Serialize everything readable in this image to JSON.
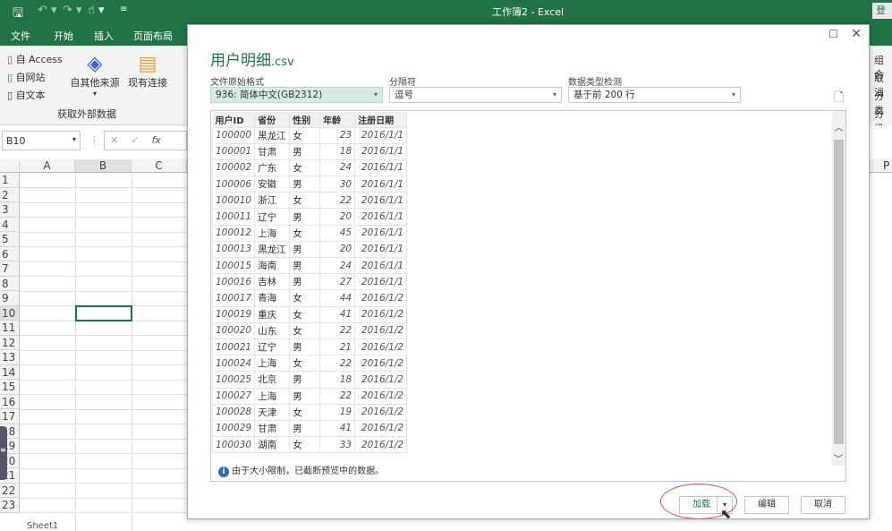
{
  "titlebar": {
    "title": "工作簿2 - Excel",
    "login": "登"
  },
  "tabs": [
    "文件",
    "开始",
    "插入",
    "页面布局"
  ],
  "ribbon": {
    "access": "自 Access",
    "web": "自网站",
    "text": "自文本",
    "other_sources": "自其他来源",
    "existing": "现有连接",
    "group_label": "获取外部数据",
    "right_items": [
      "组合",
      "取消",
      "分类",
      "分级"
    ]
  },
  "formula_bar": {
    "name_box": "B10",
    "fx": "fx"
  },
  "grid": {
    "columns": [
      "A",
      "B",
      "C"
    ],
    "right_col": "P",
    "rows": [
      "1",
      "2",
      "3",
      "4",
      "5",
      "6",
      "7",
      "8",
      "9",
      "10",
      "11",
      "12",
      "13",
      "14",
      "15",
      "16",
      "17",
      "18",
      "19",
      "20",
      "21",
      "22",
      "23"
    ],
    "selected_cell": "B10",
    "sheet_tab": "Sheet1"
  },
  "dialog": {
    "title": "用户明细",
    "title_ext": ".csv",
    "origin_label": "文件原始格式",
    "origin_value": "936: 简体中文(GB2312)",
    "delimiter_label": "分隔符",
    "delimiter_value": "逗号",
    "detect_label": "数据类型检测",
    "detect_value": "基于前 200 行",
    "columns": [
      "用户ID",
      "省份",
      "性别",
      "年龄",
      "注册日期"
    ],
    "rows": [
      [
        "100000",
        "黑龙江",
        "女",
        "23",
        "2016/1/1"
      ],
      [
        "100001",
        "甘肃",
        "男",
        "18",
        "2016/1/1"
      ],
      [
        "100002",
        "广东",
        "女",
        "24",
        "2016/1/1"
      ],
      [
        "100006",
        "安徽",
        "男",
        "30",
        "2016/1/1"
      ],
      [
        "100010",
        "浙江",
        "女",
        "22",
        "2016/1/1"
      ],
      [
        "100011",
        "辽宁",
        "男",
        "20",
        "2016/1/1"
      ],
      [
        "100012",
        "上海",
        "女",
        "45",
        "2016/1/1"
      ],
      [
        "100013",
        "黑龙江",
        "男",
        "20",
        "2016/1/1"
      ],
      [
        "100015",
        "海南",
        "男",
        "24",
        "2016/1/1"
      ],
      [
        "100016",
        "吉林",
        "男",
        "27",
        "2016/1/1"
      ],
      [
        "100017",
        "青海",
        "女",
        "44",
        "2016/1/2"
      ],
      [
        "100019",
        "重庆",
        "女",
        "41",
        "2016/1/2"
      ],
      [
        "100020",
        "山东",
        "女",
        "22",
        "2016/1/2"
      ],
      [
        "100021",
        "辽宁",
        "男",
        "21",
        "2016/1/2"
      ],
      [
        "100024",
        "上海",
        "女",
        "22",
        "2016/1/2"
      ],
      [
        "100025",
        "北京",
        "男",
        "18",
        "2016/1/2"
      ],
      [
        "100027",
        "上海",
        "男",
        "22",
        "2016/1/2"
      ],
      [
        "100028",
        "天津",
        "女",
        "19",
        "2016/1/2"
      ],
      [
        "100029",
        "甘肃",
        "男",
        "41",
        "2016/1/2"
      ],
      [
        "100030",
        "湖南",
        "女",
        "33",
        "2016/1/2"
      ]
    ],
    "notice": "由于大小限制，已截断预览中的数据。",
    "load": "加载",
    "edit": "编辑",
    "cancel": "取消"
  },
  "colors": {
    "excel_green": "#217346",
    "selected_field": "#d5ede0",
    "highlight_ellipse": "#d9534f"
  }
}
